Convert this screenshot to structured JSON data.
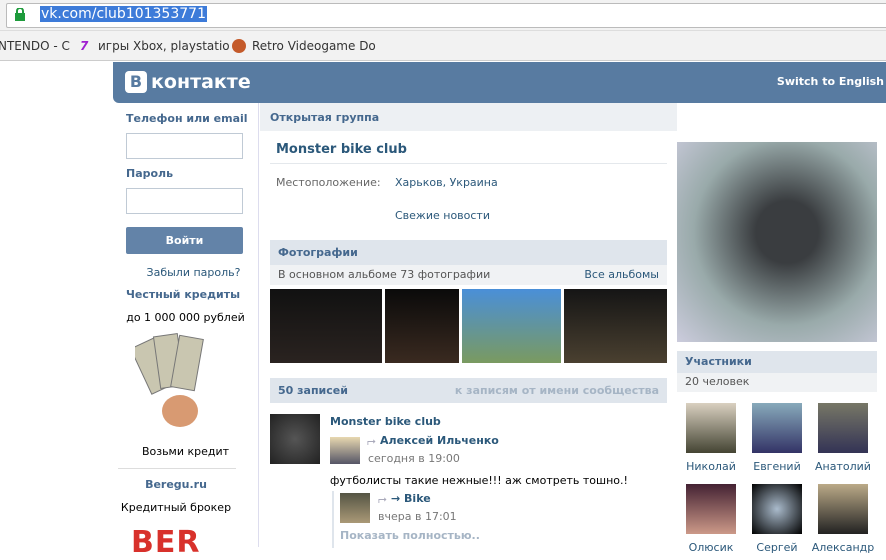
{
  "browser": {
    "url": "vk.com/club101353771",
    "bookmarks": [
      "NTENDO - C",
      "игры Xbox, playstatio",
      "Retro Videogame Do"
    ]
  },
  "header": {
    "logo_letter": "В",
    "logo_text": "контакте",
    "switch_lang": "Switch to English"
  },
  "login": {
    "phone_label": "Телефон или email",
    "password_label": "Пароль",
    "phone_value": "",
    "password_value": "",
    "submit": "Войти",
    "forgot": "Забыли пароль?"
  },
  "ads": [
    {
      "title": "Честный кредиты",
      "text": "до 1 000 000 рублей",
      "caption": "Возьми кредит"
    },
    {
      "title": "Beregu.ru",
      "text": "Кредитный брокер",
      "logo_text": "BER"
    }
  ],
  "group": {
    "type": "Открытая группа",
    "name": "Monster bike club",
    "location_label": "Местоположение:",
    "location": "Харьков, Украина",
    "news_link": "Свежие новости"
  },
  "photos": {
    "title": "Фотографии",
    "subtitle": "В основном альбоме 73 фотографии",
    "all_link": "Все альбомы"
  },
  "wall": {
    "count": "50 записей",
    "community_link": "к записям от имени сообщества",
    "post": {
      "author": "Monster bike club",
      "repost_author": "Алексей Ильченко",
      "repost_time": "сегодня в 19:00",
      "text": "футболисты такие нежные!!! аж смотреть тошно.!",
      "inner_author": "→ Bike",
      "inner_time": "вчера в 17:01",
      "show_more": "Показать полностью.."
    }
  },
  "members": {
    "title": "Участники",
    "count": "20 человек",
    "list": [
      "Николай",
      "Евгений",
      "Анатолий",
      "Олюсик",
      "Сергей",
      "Александр"
    ]
  },
  "colors": {
    "brand": "#587ba1",
    "link": "#2b587a",
    "bar": "#dfe5ec"
  }
}
